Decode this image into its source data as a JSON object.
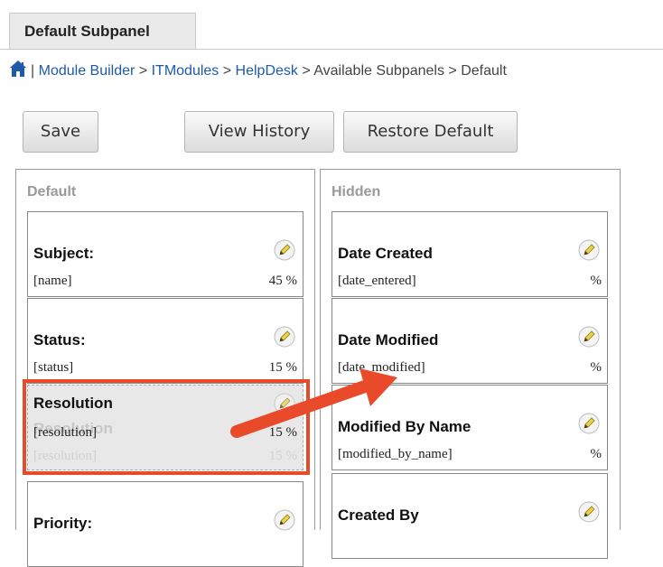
{
  "tab": {
    "label": "Default Subpanel"
  },
  "breadcrumb": {
    "separator": "|",
    "items": [
      {
        "label": "Module Builder",
        "link": true
      },
      {
        "label": ">",
        "link": false
      },
      {
        "label": "ITModules",
        "link": true
      },
      {
        "label": ">",
        "link": false
      },
      {
        "label": "HelpDesk",
        "link": true
      },
      {
        "label": "> Available Subpanels > Default",
        "link": false
      }
    ]
  },
  "toolbar": {
    "save_label": "Save",
    "history_label": "View History",
    "restore_label": "Restore Default"
  },
  "columns": {
    "default": {
      "title": "Default",
      "fields": [
        {
          "label": "Subject:",
          "name": "[name]",
          "width": "45 %"
        },
        {
          "label": "Status:",
          "name": "[status]",
          "width": "15 %"
        },
        {
          "label": "Resolution",
          "name": "[resolution]",
          "width": "15 %",
          "ghost_label": "Resolution",
          "ghost_name": "[resolution]",
          "ghost_width": "15 %"
        },
        {
          "label": "Priority:"
        }
      ]
    },
    "hidden": {
      "title": "Hidden",
      "fields": [
        {
          "label": "Date Created",
          "name": "[date_entered]",
          "width": "%"
        },
        {
          "label": "Date Modified",
          "name": "[date_modified]",
          "width": "%"
        },
        {
          "label": "Modified By Name",
          "name": "[modified_by_name]",
          "width": "%"
        },
        {
          "label": "Created By"
        }
      ]
    }
  },
  "icons": {
    "home": "home-icon",
    "edit": "pencil-icon"
  },
  "colors": {
    "link": "#1d5ba8",
    "annotation": "#e84a2a"
  }
}
